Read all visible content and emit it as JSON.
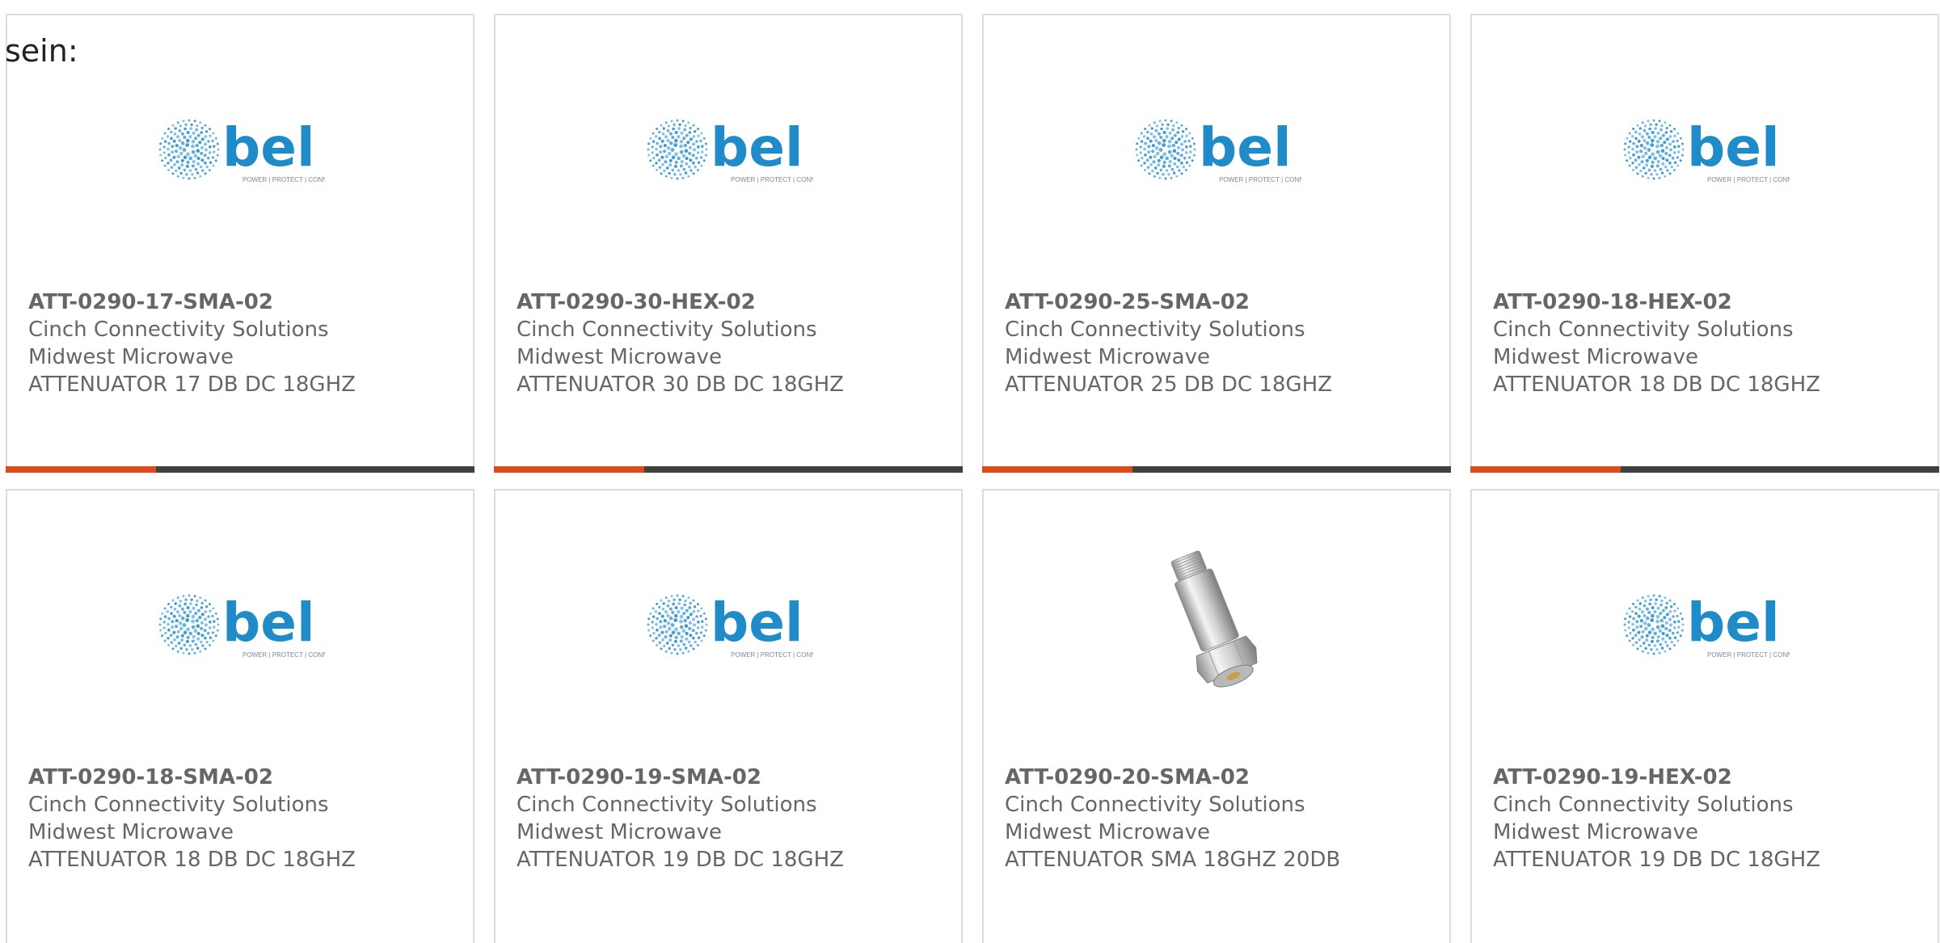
{
  "intro_text": "sein:",
  "colors": {
    "accent": "#e04a19",
    "bar": "#414141",
    "bel_blue": "#1f8cc9",
    "text": "#666666"
  },
  "products": [
    {
      "part_number": "ATT-0290-17-SMA-02",
      "manufacturer": "Cinch Connectivity Solutions",
      "sub_brand": "Midwest Microwave",
      "description": "ATTENUATOR 17 DB DC 18GHZ",
      "image": "bel-logo",
      "logo_text": "bel",
      "logo_tagline": "POWER | PROTECT | CONNECT",
      "progress_fraction": 0.32
    },
    {
      "part_number": "ATT-0290-30-HEX-02",
      "manufacturer": "Cinch Connectivity Solutions",
      "sub_brand": "Midwest Microwave",
      "description": "ATTENUATOR 30 DB DC 18GHZ",
      "image": "bel-logo",
      "logo_text": "bel",
      "logo_tagline": "POWER | PROTECT | CONNECT",
      "progress_fraction": 0.32
    },
    {
      "part_number": "ATT-0290-25-SMA-02",
      "manufacturer": "Cinch Connectivity Solutions",
      "sub_brand": "Midwest Microwave",
      "description": "ATTENUATOR 25 DB DC 18GHZ",
      "image": "bel-logo",
      "logo_text": "bel",
      "logo_tagline": "POWER | PROTECT | CONNECT",
      "progress_fraction": 0.32
    },
    {
      "part_number": "ATT-0290-18-HEX-02",
      "manufacturer": "Cinch Connectivity Solutions",
      "sub_brand": "Midwest Microwave",
      "description": "ATTENUATOR 18 DB DC 18GHZ",
      "image": "bel-logo",
      "logo_text": "bel",
      "logo_tagline": "POWER | PROTECT | CONNECT",
      "progress_fraction": 0.32
    },
    {
      "part_number": "ATT-0290-18-SMA-02",
      "manufacturer": "Cinch Connectivity Solutions",
      "sub_brand": "Midwest Microwave",
      "description": "ATTENUATOR 18 DB DC 18GHZ",
      "image": "bel-logo",
      "logo_text": "bel",
      "logo_tagline": "POWER | PROTECT | CONNECT"
    },
    {
      "part_number": "ATT-0290-19-SMA-02",
      "manufacturer": "Cinch Connectivity Solutions",
      "sub_brand": "Midwest Microwave",
      "description": "ATTENUATOR 19 DB DC 18GHZ",
      "image": "bel-logo",
      "logo_text": "bel",
      "logo_tagline": "POWER | PROTECT | CONNECT"
    },
    {
      "part_number": "ATT-0290-20-SMA-02",
      "manufacturer": "Cinch Connectivity Solutions",
      "sub_brand": "Midwest Microwave",
      "description": "ATTENUATOR SMA 18GHZ 20DB",
      "image": "sma-attenuator-photo"
    },
    {
      "part_number": "ATT-0290-19-HEX-02",
      "manufacturer": "Cinch Connectivity Solutions",
      "sub_brand": "Midwest Microwave",
      "description": "ATTENUATOR 19 DB DC 18GHZ",
      "image": "bel-logo",
      "logo_text": "bel",
      "logo_tagline": "POWER | PROTECT | CONNECT"
    }
  ]
}
